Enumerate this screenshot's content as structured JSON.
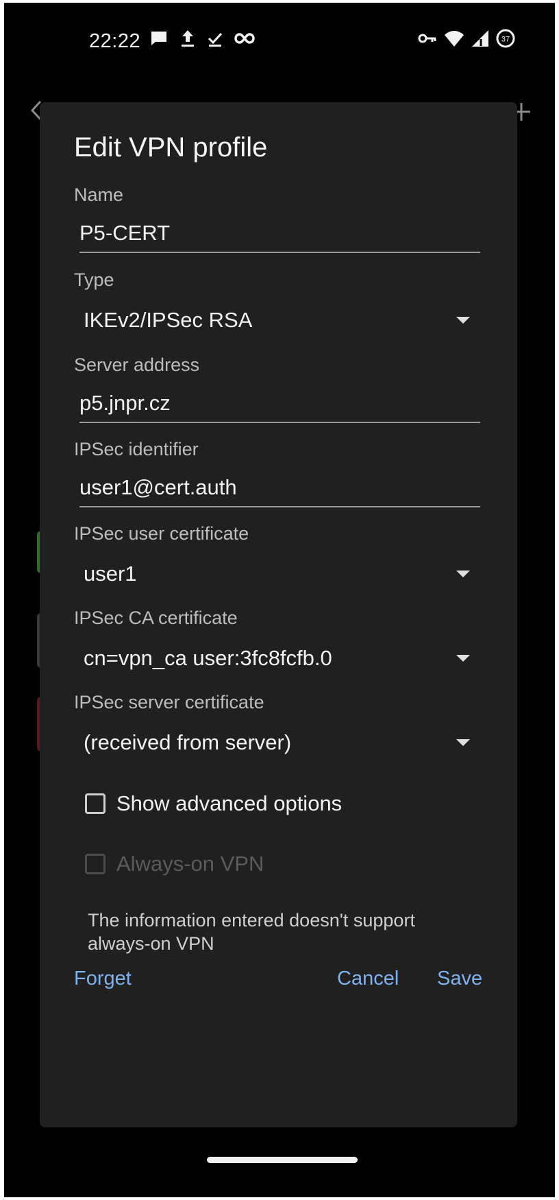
{
  "status_bar": {
    "time": "22:22",
    "left_icons": [
      "message-icon",
      "upload-icon",
      "check-icon",
      "infinity-icon"
    ],
    "right_icons": [
      "vpn-key-icon",
      "wifi-icon",
      "cell-signal-icon",
      "battery-icon"
    ],
    "battery_level": "37"
  },
  "dialog": {
    "title": "Edit VPN profile",
    "fields": {
      "name": {
        "label": "Name",
        "value": "P5-CERT"
      },
      "type": {
        "label": "Type",
        "value": "IKEv2/IPSec RSA"
      },
      "server_address": {
        "label": "Server address",
        "value": "p5.jnpr.cz"
      },
      "ipsec_identifier": {
        "label": "IPSec identifier",
        "value": "user1@cert.auth"
      },
      "ipsec_user_certificate": {
        "label": "IPSec user certificate",
        "value": "user1"
      },
      "ipsec_ca_certificate": {
        "label": "IPSec CA certificate",
        "value": "cn=vpn_ca user:3fc8fcfb.0"
      },
      "ipsec_server_certificate": {
        "label": "IPSec server certificate",
        "value": "(received from server)"
      }
    },
    "show_advanced_options": {
      "label": "Show advanced options",
      "checked": false
    },
    "always_on_vpn": {
      "label": "Always-on VPN",
      "checked": false,
      "disabled": true
    },
    "info_text": "The information entered doesn't support always-on VPN",
    "buttons": {
      "forget": "Forget",
      "cancel": "Cancel",
      "save": "Save"
    }
  },
  "colors": {
    "dialog_background": "#202020",
    "accent": "#7eb1ef",
    "screen_background": "#000000"
  }
}
